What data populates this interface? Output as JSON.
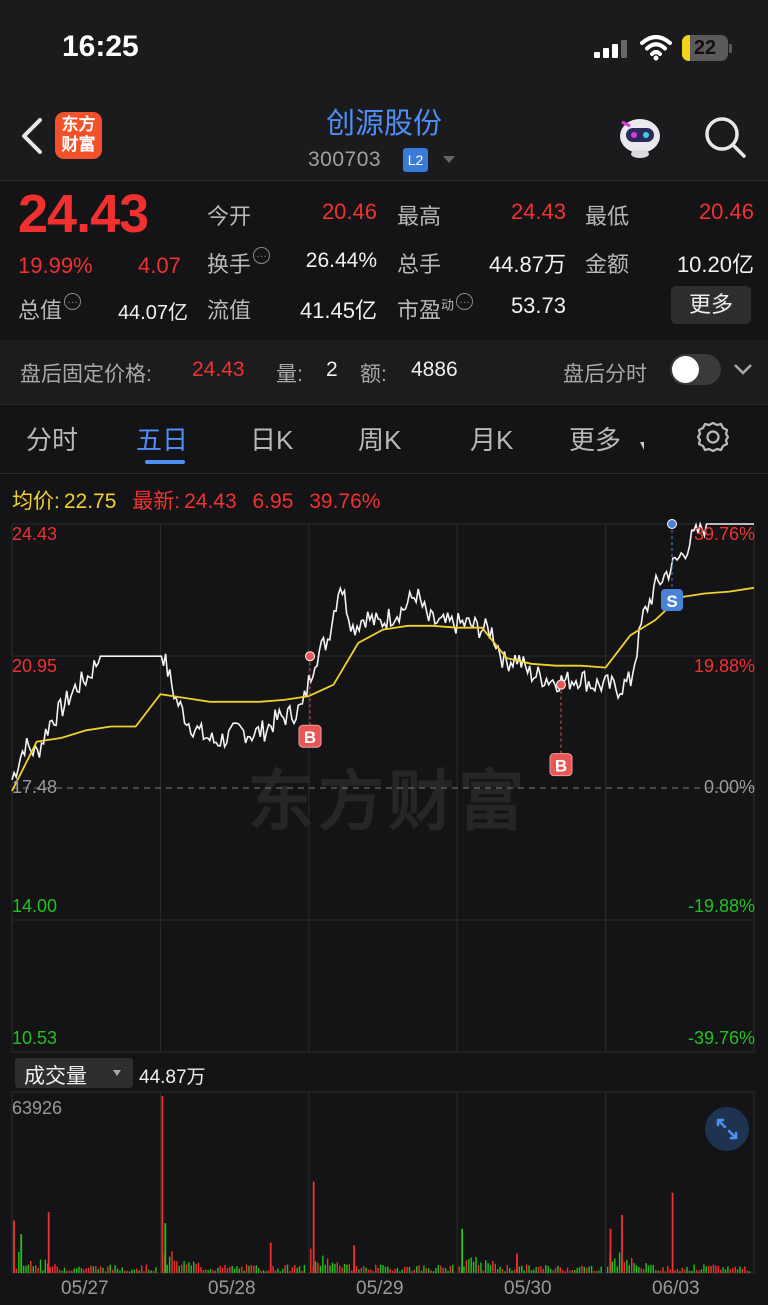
{
  "status_bar": {
    "time": "16:25",
    "battery": "22"
  },
  "header": {
    "stock_name": "创源股份",
    "stock_code": "300703",
    "level_badge": "L2",
    "logo_text_line1": "东方",
    "logo_text_line2": "财富"
  },
  "quote": {
    "price": "24.43",
    "change_pct": "19.99%",
    "change_amt": "4.07",
    "fields": [
      {
        "label": "今开",
        "value": "20.46"
      },
      {
        "label": "最高",
        "value": "24.43"
      },
      {
        "label": "最低",
        "value": "20.46"
      },
      {
        "label": "换手",
        "value": "26.44%"
      },
      {
        "label": "总手",
        "value": "44.87万"
      },
      {
        "label": "金额",
        "value": "10.20亿"
      },
      {
        "label": "总值",
        "value": "44.07亿"
      },
      {
        "label": "流值",
        "value": "41.45亿"
      },
      {
        "label": "市盈",
        "label_sup": "动",
        "value": "53.73"
      }
    ],
    "more_button": "更多"
  },
  "after_hours": {
    "label": "盘后固定价格:",
    "price": "24.43",
    "volume_label": "量:",
    "volume": "2",
    "amount_label": "额:",
    "amount": "4886",
    "switch_label": "盘后分时",
    "switch_on": false
  },
  "tabs": [
    {
      "label": "分时",
      "active": false
    },
    {
      "label": "五日",
      "active": true
    },
    {
      "label": "日K",
      "active": false
    },
    {
      "label": "周K",
      "active": false
    },
    {
      "label": "月K",
      "active": false
    },
    {
      "label": "更多",
      "active": false
    }
  ],
  "legend": {
    "avg_label": "均价:",
    "avg_value": "22.75",
    "latest_label": "最新:",
    "latest_value": "24.43",
    "latest_change": "6.95",
    "latest_pct": "39.76%"
  },
  "watermark": "东方财富",
  "colors": {
    "up": "#f0312f",
    "down": "#21c21f",
    "avg_line": "#f2d02c",
    "accent": "#4e8ff5"
  },
  "chart_data": {
    "type": "line",
    "x_labels": [
      "05/27",
      "05/28",
      "05/29",
      "05/30",
      "06/03"
    ],
    "y_left_ticks": [
      "24.43",
      "20.95",
      "17.48",
      "14.00",
      "10.53"
    ],
    "y_right_ticks": [
      "39.76%",
      "19.88%",
      "0.00%",
      "-19.88%",
      "-39.76%"
    ],
    "ylim": [
      10.53,
      24.43
    ],
    "base_price": 17.48,
    "series": [
      {
        "kind": "price",
        "values": [
          17.7,
          18.6,
          18.4,
          19.2,
          19.6,
          20.1,
          20.4,
          20.95,
          20.95,
          20.95,
          20.95,
          20.95,
          20.95,
          19.8,
          19.2,
          18.9,
          18.7,
          18.8,
          19.0,
          18.9,
          19.0,
          19.3,
          19.4,
          19.6,
          20.9,
          21.4,
          22.9,
          21.7,
          22.0,
          21.8,
          22.0,
          22.2,
          22.6,
          21.9,
          21.8,
          21.8,
          21.8,
          21.7,
          21.6,
          20.8,
          20.9,
          20.5,
          20.4,
          20.3,
          20.3,
          20.4,
          20.2,
          20.2,
          20.1,
          20.3,
          22.0,
          22.8,
          23.2,
          23.6,
          24.1,
          24.43,
          24.43,
          24.43,
          24.43
        ]
      },
      {
        "kind": "avg",
        "values": [
          17.4,
          18.7,
          18.8,
          19.0,
          19.1,
          19.1,
          19.95,
          19.85,
          19.75,
          19.75,
          19.75,
          19.8,
          19.9,
          20.2,
          21.3,
          21.65,
          21.75,
          21.75,
          21.7,
          21.7,
          20.9,
          20.75,
          20.7,
          20.7,
          20.65,
          21.5,
          21.9,
          22.5,
          22.6,
          22.65,
          22.75
        ]
      }
    ],
    "markers": [
      {
        "label": "B",
        "price": 20.95
      },
      {
        "label": "B",
        "price": 20.2
      },
      {
        "label": "S",
        "price": 24.43
      }
    ],
    "volume": {
      "label": "成交量",
      "total": "44.87万",
      "max_label": "63926",
      "max": 63926,
      "spikes": [
        {
          "day": 0,
          "pos": 0.0,
          "value": 19000,
          "color": "red"
        },
        {
          "day": 0,
          "pos": 0.24,
          "value": 22000,
          "color": "red"
        },
        {
          "day": 0,
          "pos": 0.05,
          "value": 14000,
          "color": "green"
        },
        {
          "day": 1,
          "pos": 0.0,
          "value": 63926,
          "color": "red"
        },
        {
          "day": 1,
          "pos": 0.02,
          "value": 18000,
          "color": "green"
        },
        {
          "day": 1,
          "pos": 0.75,
          "value": 11000,
          "color": "red"
        },
        {
          "day": 2,
          "pos": 0.02,
          "value": 33000,
          "color": "red"
        },
        {
          "day": 2,
          "pos": 0.3,
          "value": 10000,
          "color": "red"
        },
        {
          "day": 3,
          "pos": 0.02,
          "value": 16000,
          "color": "green"
        },
        {
          "day": 3,
          "pos": 0.4,
          "value": 7000,
          "color": "red"
        },
        {
          "day": 4,
          "pos": 0.02,
          "value": 16000,
          "color": "red"
        },
        {
          "day": 4,
          "pos": 0.1,
          "value": 21000,
          "color": "red"
        },
        {
          "day": 4,
          "pos": 0.45,
          "value": 29000,
          "color": "red"
        }
      ]
    }
  }
}
